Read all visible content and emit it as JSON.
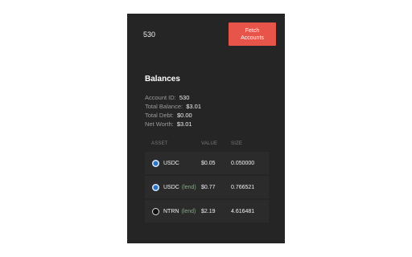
{
  "header": {
    "account_id": "530",
    "fetch_button_label": "Fetch Accounts"
  },
  "balances": {
    "title": "Balances",
    "summary": [
      {
        "label": "Account ID:",
        "value": "530"
      },
      {
        "label": "Total Balance:",
        "value": "$3.01"
      },
      {
        "label": "Total Debt:",
        "value": "$0.00"
      },
      {
        "label": "Net Worth:",
        "value": "$3.01"
      }
    ],
    "table": {
      "columns": [
        "ASSET",
        "VALUE",
        "SIZE"
      ],
      "rows": [
        {
          "asset": "USDC",
          "tag": "",
          "icon": "usdc-icon",
          "value": "$0.05",
          "size": "0.050000"
        },
        {
          "asset": "USDC",
          "tag": "(lend)",
          "icon": "usdc-icon",
          "value": "$0.77",
          "size": "0.766521"
        },
        {
          "asset": "NTRN",
          "tag": "(lend)",
          "icon": "ntrn-icon",
          "value": "$2.19",
          "size": "4.616481"
        }
      ]
    }
  },
  "colors": {
    "panel_bg": "#252525",
    "button_bg": "#e6544a",
    "lend_tag": "#8ea38c"
  }
}
